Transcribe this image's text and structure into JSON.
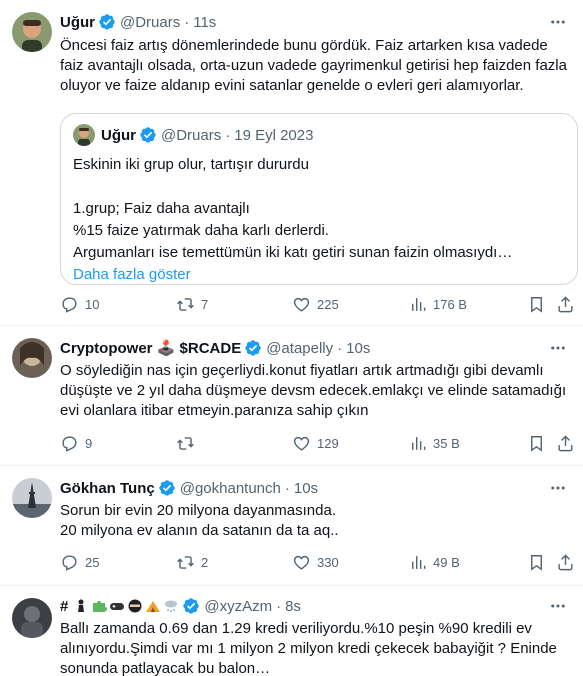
{
  "tweets": [
    {
      "name": "Uğur",
      "handle": "@Druars",
      "dot": "·",
      "time": "11s",
      "text": "Öncesi faiz artış dönemlerindede bunu gördük. Faiz artarken kısa vadede faiz avantajlı olsada, orta-uzun vadede gayrimenkul getirisi hep faizden fazla oluyor ve faize aldanıp evini satanlar genelde o evleri geri alamıyorlar.",
      "quote": {
        "name": "Uğur",
        "handle": "@Druars",
        "dot": "·",
        "date": "19 Eyl 2023",
        "lines": [
          "Eskinin iki grup olur, tartışır dururdu",
          "",
          "1.grup; Faiz daha avantajlı",
          "%15 faize yatırmak daha karlı derlerdi.",
          "Argumanları ise temettümün iki katı getiri sunan faizin olmasıydı…"
        ],
        "show_more": "Daha fazla göster"
      },
      "replies": "10",
      "retweets": "7",
      "likes": "225",
      "views": "176 B"
    },
    {
      "name": "Cryptopower 🕹️ $RCADE",
      "handle": "@atapelly",
      "dot": "·",
      "time": "10s",
      "text": "O söylediğin nas için geçerliydi.konut fiyatları artık artmadığı gibi devamlı düşüşte ve 2 yıl daha düşmeye devsm edecek.emlakçı ve elinde satamadığı evi olanlara itibar etmeyin.paranıza sahip çıkın",
      "replies": "9",
      "retweets": "",
      "likes": "129",
      "views": "35 B"
    },
    {
      "name": "Gökhan Tunç",
      "handle": "@gokhantunch",
      "dot": "·",
      "time": "10s",
      "text": "Sorun bir evin 20 milyona dayanmasında.\n20 milyona ev alanın da satanın da ta aq..",
      "replies": "25",
      "retweets": "2",
      "likes": "330",
      "views": "49 B"
    },
    {
      "name": "#",
      "handle": "@xyzAzm",
      "dot": "·",
      "time": "8s",
      "text": "Ballı zamanda 0.69 dan 1.29 kredi veriliyordu.%10 peşin %90 kredili ev alınıyordu.Şimdi var mı 1 milyon 2 milyon kredi çekecek babayiğit ? Eninde sonunda patlayacak bu balon…"
    }
  ],
  "icons": {
    "reply": "reply-icon",
    "retweet": "retweet-icon",
    "like": "heart-icon",
    "views": "views-chart-icon",
    "bookmark": "bookmark-icon",
    "share": "share-icon",
    "more": "more-dots-icon",
    "verified": "verified-badge-icon"
  },
  "colors": {
    "accent": "#1d9bf0",
    "secondary_text": "#536471",
    "border": "#eff3f4"
  }
}
